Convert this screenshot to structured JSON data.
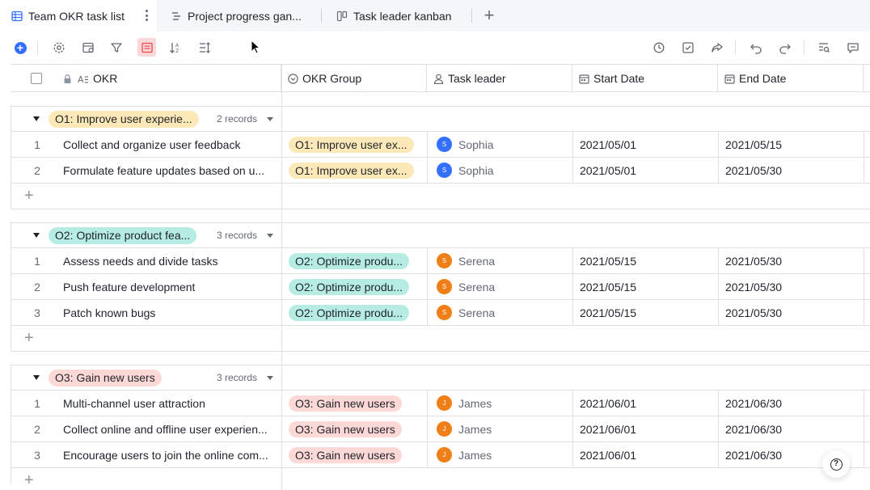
{
  "tabs": [
    {
      "label": "Team OKR task list",
      "icon": "grid-table-icon",
      "active": true
    },
    {
      "label": "Project progress gan...",
      "icon": "gantt-icon",
      "active": false
    },
    {
      "label": "Task leader kanban",
      "icon": "kanban-icon",
      "active": false
    }
  ],
  "toolbar": {
    "left_icons": [
      "add-record-icon",
      "settings-icon",
      "field-icon",
      "filter-icon",
      "group-icon",
      "sort-icon",
      "row-height-icon"
    ],
    "right_icons": [
      "history-icon",
      "task-check-icon",
      "share-icon",
      "undo-icon",
      "redo-icon",
      "search-icon",
      "comment-icon"
    ]
  },
  "columns": {
    "okr": "OKR",
    "okr_group": "OKR Group",
    "task_leader": "Task leader",
    "start_date": "Start Date",
    "end_date": "End Date"
  },
  "colors": {
    "o1_tag": "#fde9b8",
    "o2_tag": "#b6ece4",
    "o3_tag": "#fcd8d6",
    "avatar_sophia": "#3370ff",
    "avatar_serena": "#f07f18",
    "avatar_james": "#f07f18",
    "accent": "#3370ff"
  },
  "groups": [
    {
      "tag": "O1: Improve user experie...",
      "count": "2 records",
      "rows": [
        {
          "idx": "1",
          "okr": "Collect and organize user feedback",
          "group": "O1: Improve user ex...",
          "leader": "Sophia",
          "initial": "S",
          "start": "2021/05/01",
          "end": "2021/05/15"
        },
        {
          "idx": "2",
          "okr": "Formulate feature updates based on u...",
          "group": "O1: Improve user ex...",
          "leader": "Sophia",
          "initial": "S",
          "start": "2021/05/01",
          "end": "2021/05/30"
        }
      ]
    },
    {
      "tag": "O2: Optimize product fea...",
      "count": "3 records",
      "rows": [
        {
          "idx": "1",
          "okr": "Assess needs and divide tasks",
          "group": "O2: Optimize produ...",
          "leader": "Serena",
          "initial": "S",
          "start": "2021/05/15",
          "end": "2021/05/30"
        },
        {
          "idx": "2",
          "okr": "Push feature development",
          "group": "O2: Optimize produ...",
          "leader": "Serena",
          "initial": "S",
          "start": "2021/05/15",
          "end": "2021/05/30"
        },
        {
          "idx": "3",
          "okr": "Patch known bugs",
          "group": "O2: Optimize produ...",
          "leader": "Serena",
          "initial": "S",
          "start": "2021/05/15",
          "end": "2021/05/30"
        }
      ]
    },
    {
      "tag": "O3: Gain new users",
      "count": "3 records",
      "rows": [
        {
          "idx": "1",
          "okr": "Multi-channel user attraction",
          "group": "O3: Gain new users",
          "leader": "James",
          "initial": "J",
          "start": "2021/06/01",
          "end": "2021/06/30"
        },
        {
          "idx": "2",
          "okr": "Collect online and offline user experien...",
          "group": "O3: Gain new users",
          "leader": "James",
          "initial": "J",
          "start": "2021/06/01",
          "end": "2021/06/30"
        },
        {
          "idx": "3",
          "okr": "Encourage users to join the online com...",
          "group": "O3: Gain new users",
          "leader": "James",
          "initial": "J",
          "start": "2021/06/01",
          "end": "2021/06/30"
        }
      ]
    }
  ],
  "help": {
    "icon": "help-icon"
  }
}
